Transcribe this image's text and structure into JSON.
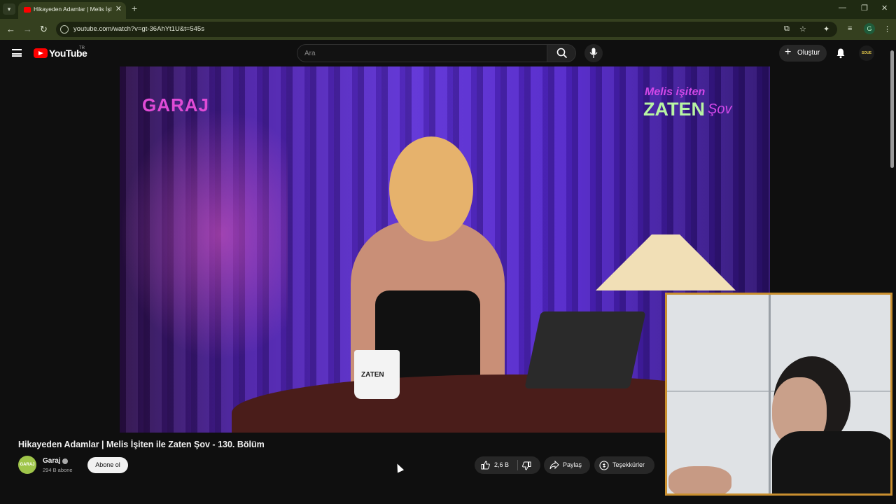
{
  "browser": {
    "tab_title": "Hikayeden Adamlar | Melis İşiten",
    "url": "youtube.com/watch?v=gt-36AhYt1U&t=545s",
    "profile_initial": "G"
  },
  "youtube": {
    "logo_text": "YouTube",
    "country_code": "TR",
    "search_placeholder": "Ara",
    "create_label": "Oluştur",
    "avatar_text": "SOUE"
  },
  "video": {
    "channel_logo_text": "GARAJ",
    "show_logo_line1": "Melis işiten",
    "show_logo_line2": "ZATEN",
    "show_logo_line3": "Şov",
    "mug_text": "ZATEN"
  },
  "info": {
    "title": "Hikayeden Adamlar | Melis İşiten ile Zaten Şov - 130. Bölüm",
    "channel_name": "Garaj",
    "channel_avatar_text": "GARAJ",
    "subscribers": "294 B abone",
    "subscribe_label": "Abone ol",
    "like_count": "2,6 B",
    "share_label": "Paylaş",
    "thanks_label": "Teşekkürler"
  },
  "colors": {
    "accent_red": "#ff0000",
    "chrome_green": "#35401f",
    "webcam_border": "#c98f2f"
  }
}
